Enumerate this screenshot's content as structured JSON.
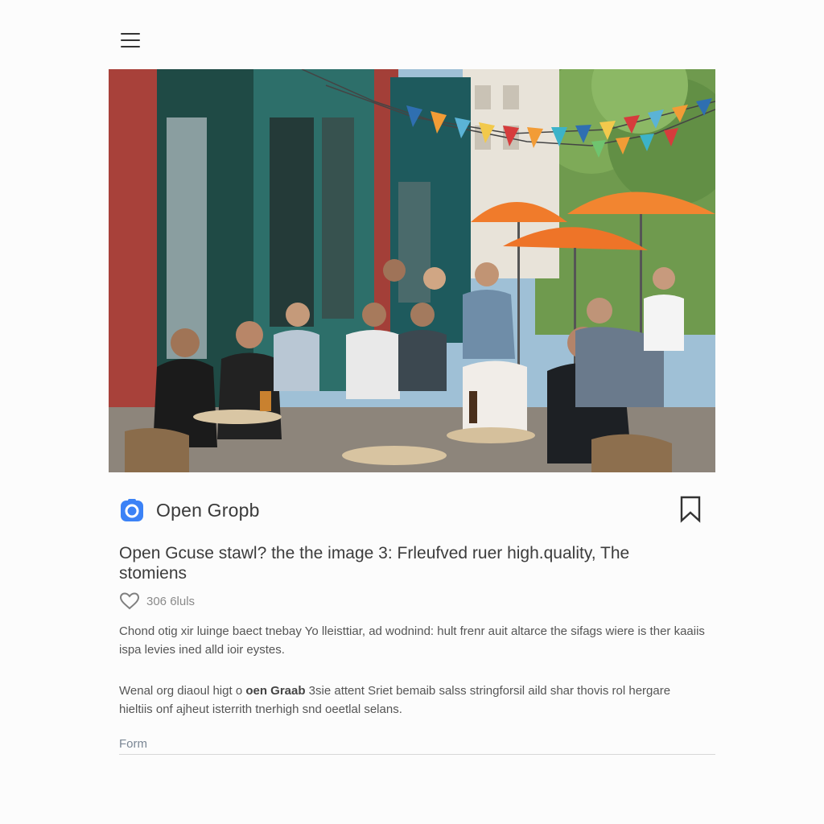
{
  "header": {
    "menu_icon": "hamburger-menu-icon"
  },
  "hero_image": {
    "description_icon": "photo"
  },
  "source": {
    "logo_icon": "camera-app-icon",
    "name": "Open Gropb",
    "bookmark_icon": "bookmark-icon",
    "accent_color": "#3b82f6"
  },
  "post": {
    "headline": "Open Gcuse stawl? the the image 3: Frleufved ruer high.quality, The stomiens",
    "likes_icon": "heart-outline-icon",
    "likes_text": "306 6luls",
    "paragraph1": "Chond otig xir luinge baect tnebay Yo lleisttiar, ad wodnind: hult frenr auit altarce the sifags wiere is ther kaaiis ispa levies ined alld ioir eystes.",
    "paragraph2_pre": "Wenal org diaoul higt o ",
    "paragraph2_bold": "oen Graab",
    "paragraph2_post": " 3sie attent Sriet bemaib salss stringforsil aild shar thovis rol hergare hieltiis onf ajheut isterrith tnerhigh snd oeetlal selans."
  },
  "form": {
    "label": "Form"
  }
}
